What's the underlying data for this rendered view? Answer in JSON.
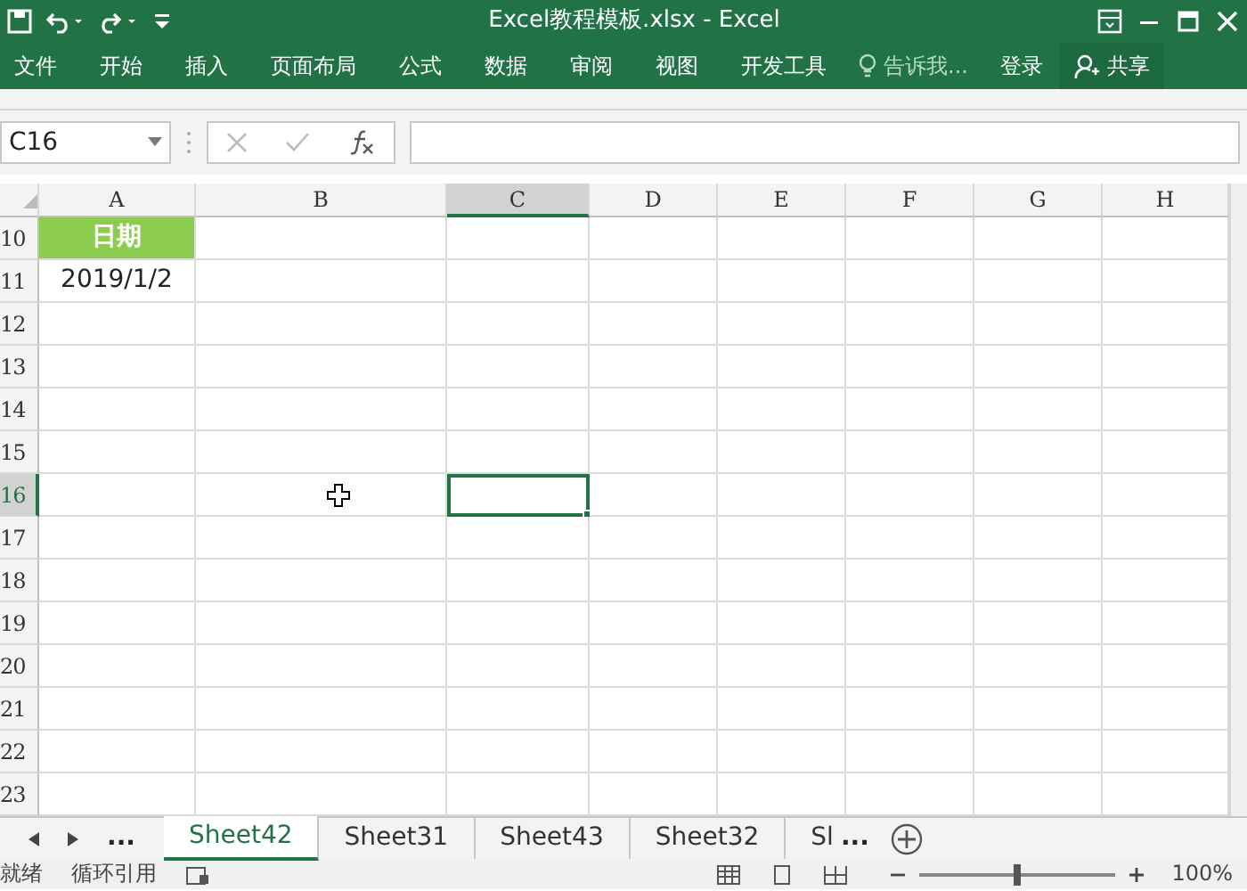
{
  "window": {
    "title": "Excel教程模板.xlsx - Excel"
  },
  "ribbon": {
    "tabs": [
      {
        "label": "文件",
        "selected": false
      },
      {
        "label": "开始",
        "selected": false
      },
      {
        "label": "插入",
        "selected": false
      },
      {
        "label": "页面布局",
        "selected": false
      },
      {
        "label": "公式",
        "selected": false
      },
      {
        "label": "数据",
        "selected": false
      },
      {
        "label": "审阅",
        "selected": false
      },
      {
        "label": "视图",
        "selected": false
      },
      {
        "label": "开发工具",
        "selected": false
      }
    ],
    "tell_me": "告诉我...",
    "login": "登录",
    "share": "共享"
  },
  "formula_bar": {
    "name_box": "C16"
  },
  "columns": [
    {
      "label": "A",
      "selected": false
    },
    {
      "label": "B",
      "selected": false
    },
    {
      "label": "C",
      "selected": true
    },
    {
      "label": "D",
      "selected": false
    },
    {
      "label": "E",
      "selected": false
    },
    {
      "label": "F",
      "selected": false
    },
    {
      "label": "G",
      "selected": false
    },
    {
      "label": "H",
      "selected": false
    }
  ],
  "rows": [
    {
      "number": "10",
      "selected": false,
      "cells": [
        {
          "text": "日期",
          "kind": "header"
        }
      ]
    },
    {
      "number": "11",
      "selected": false,
      "cells": [
        {
          "text": "2019/1/2",
          "kind": "value"
        }
      ]
    },
    {
      "number": "12",
      "selected": false,
      "cells": []
    },
    {
      "number": "13",
      "selected": false,
      "cells": []
    },
    {
      "number": "14",
      "selected": false,
      "cells": []
    },
    {
      "number": "15",
      "selected": false,
      "cells": []
    },
    {
      "number": "16",
      "selected": true,
      "cells": []
    },
    {
      "number": "17",
      "selected": false,
      "cells": []
    },
    {
      "number": "18",
      "selected": false,
      "cells": []
    },
    {
      "number": "19",
      "selected": false,
      "cells": []
    },
    {
      "number": "20",
      "selected": false,
      "cells": []
    },
    {
      "number": "21",
      "selected": false,
      "cells": []
    },
    {
      "number": "22",
      "selected": false,
      "cells": []
    },
    {
      "number": "23",
      "selected": false,
      "cells": []
    }
  ],
  "sheet_tabs": {
    "more_left": "...",
    "tabs": [
      {
        "label": "Sheet42",
        "selected": true
      },
      {
        "label": "Sheet31",
        "selected": false
      },
      {
        "label": "Sheet43",
        "selected": false
      },
      {
        "label": "Sheet32",
        "selected": false
      },
      {
        "label": "Sl",
        "selected": false
      }
    ],
    "more_right": "..."
  },
  "status_bar": {
    "mode": "就绪",
    "circular_ref": "循环引用",
    "zoom_label": "100%",
    "zoom": {
      "level": 0.5
    }
  }
}
